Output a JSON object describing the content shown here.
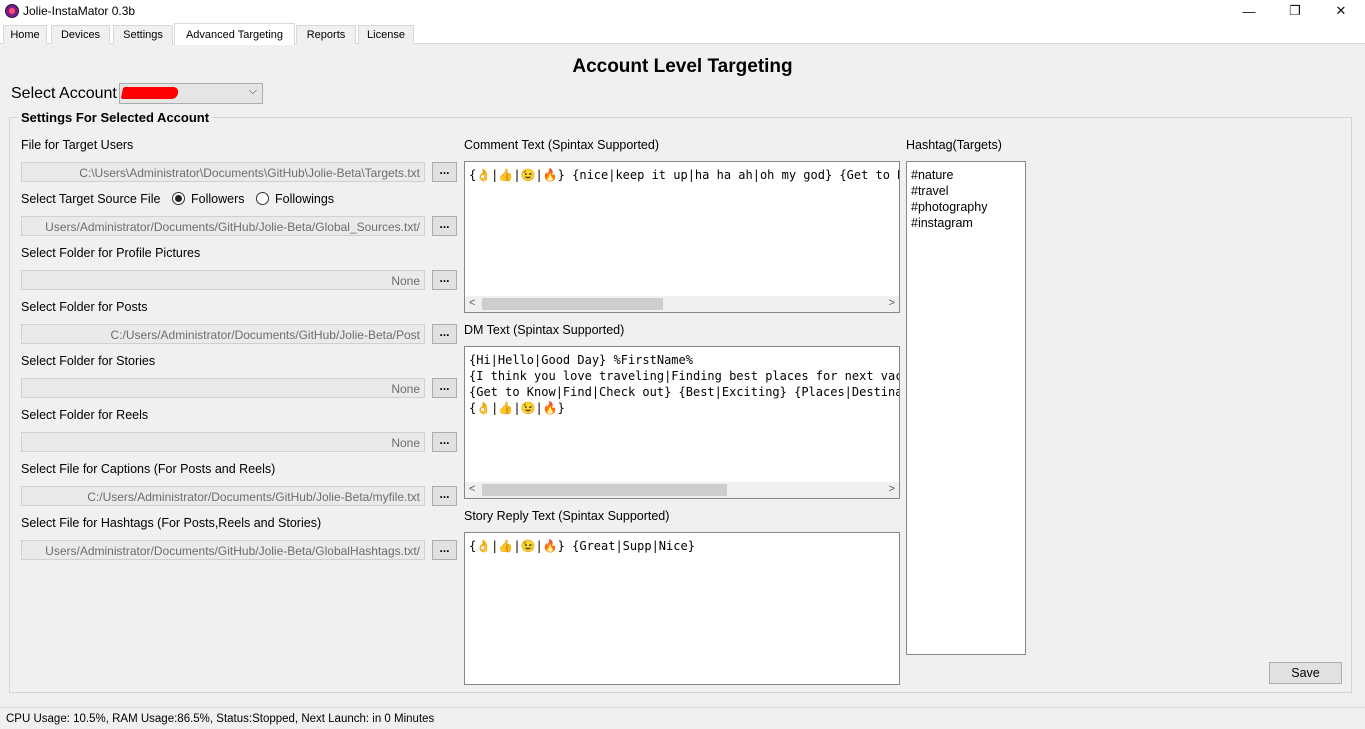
{
  "window": {
    "title": "Jolie-InstaMator 0.3b",
    "minimize": "—",
    "maximize": "❐",
    "close": "✕"
  },
  "tabs": [
    "Home",
    "Devices",
    "Settings",
    "Advanced Targeting",
    "Reports",
    "License"
  ],
  "active_tab": "Advanced Targeting",
  "heading": "Account Level Targeting",
  "account": {
    "label": "Select Account",
    "chevron": "⌵"
  },
  "group_title": "Settings For Selected Account",
  "browse_label": "...",
  "fields": {
    "target_users": {
      "label": "File for Target Users",
      "value": "C:\\Users\\Administrator\\Documents\\GitHub\\Jolie-Beta\\Targets.txt"
    },
    "target_source": {
      "label": "Select Target Source File",
      "options": [
        "Followers",
        "Followings"
      ],
      "selected": "Followers",
      "value": "/Users/Administrator/Documents/GitHub/Jolie-Beta/Global_Sources.txt"
    },
    "profile_pictures": {
      "label": "Select Folder for Profile Pictures",
      "value": "None"
    },
    "posts": {
      "label": "Select Folder for Posts",
      "value": "C:/Users/Administrator/Documents/GitHub/Jolie-Beta/Post"
    },
    "stories": {
      "label": "Select Folder for Stories",
      "value": "None"
    },
    "reels": {
      "label": "Select Folder for Reels",
      "value": "None"
    },
    "captions": {
      "label": "Select File for Captions (For Posts and Reels)",
      "value": "C:/Users/Administrator/Documents/GitHub/Jolie-Beta/myfile.txt"
    },
    "hashtags_file": {
      "label": "Select File for Hashtags (For Posts,Reels and Stories)",
      "value": "/Users/Administrator/Documents/GitHub/Jolie-Beta/GlobalHashtags.txt"
    }
  },
  "comment": {
    "label": "Comment Text (Spintax Supported)",
    "text": "{👌|👍|😉|🔥} {nice|keep it up|ha ha ah|oh my god} {Get to Know|Find|Check out}"
  },
  "dm": {
    "label": "DM Text (Spintax Supported)",
    "text": "{Hi|Hello|Good Day} %FirstName%\n{I think you love traveling|Finding best places for next vacation trip?|Want to travel}\n{Get to Know|Find|Check out} {Best|Exciting} {Places|Destinations|Locations}\n{👌|👍|😉|🔥}"
  },
  "story_reply": {
    "label": "Story Reply Text (Spintax Supported)",
    "text": "{👌|👍|😉|🔥} {Great|Supp|Nice}"
  },
  "hashtags": {
    "label": "Hashtag(Targets)",
    "text": "#nature\n#travel\n#photography\n#instagram"
  },
  "save_label": "Save",
  "status": "CPU Usage: 10.5%, RAM Usage:86.5%, Status:Stopped, Next Launch: in 0 Minutes",
  "colors": {
    "redaction": "#ff0000",
    "background": "#f0f0f0"
  }
}
